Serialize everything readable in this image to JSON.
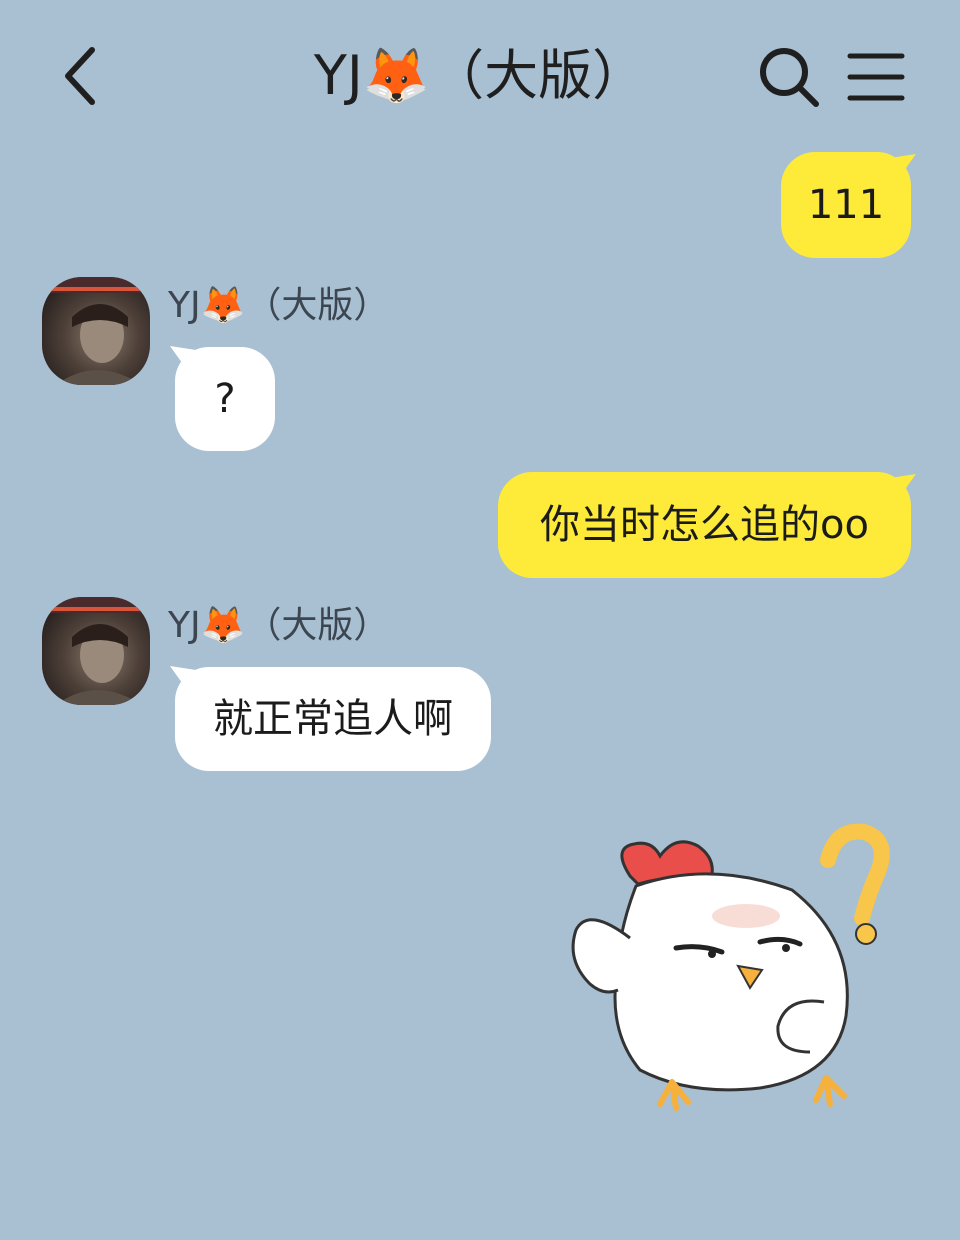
{
  "header": {
    "title": "YJ🦊（大版）",
    "back_icon": "chevron-left-icon",
    "search_icon": "search-icon",
    "menu_icon": "hamburger-menu-icon"
  },
  "colors": {
    "background": "#a9bfd2",
    "my_bubble": "#fdea39",
    "their_bubble": "#ffffff"
  },
  "messages": [
    {
      "from": "me",
      "text": "111"
    },
    {
      "from": "them",
      "sender": "YJ🦊（大版）",
      "text": "?"
    },
    {
      "from": "me",
      "text": "你当时怎么追的oo"
    },
    {
      "from": "them",
      "sender": "YJ🦊（大版）",
      "text": "就正常追人啊"
    },
    {
      "from": "me",
      "type": "sticker",
      "sticker": "chicken-question-sticker"
    }
  ]
}
